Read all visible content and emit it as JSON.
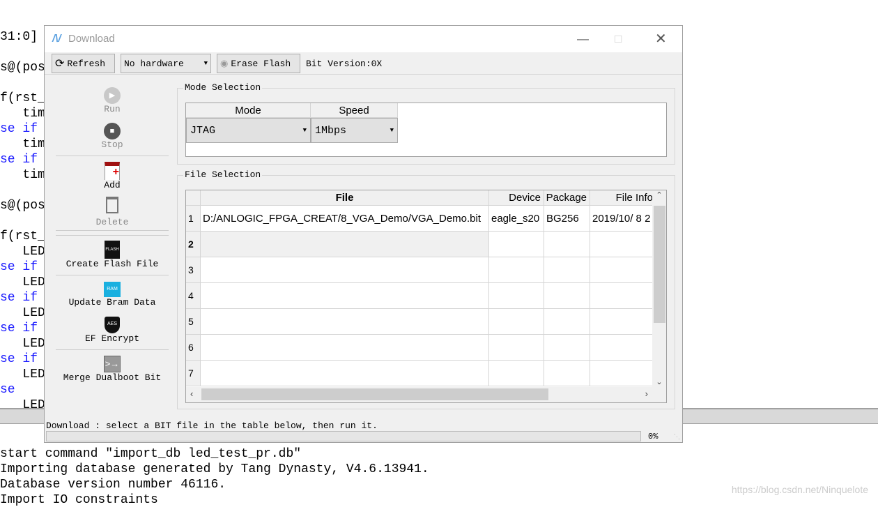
{
  "editor": {
    "lines": [
      {
        "text": "31:0]",
        "kw": false
      },
      {
        "text": "s@(pos",
        "kw": false
      },
      {
        "text": "f(rst_",
        "kw": false
      },
      {
        "text": "   tim",
        "kw": false
      },
      {
        "text": "se if",
        "kw": true
      },
      {
        "text": "   tim",
        "kw": false
      },
      {
        "text": "se if",
        "kw": true
      },
      {
        "text": "   tim",
        "kw": false
      },
      {
        "text": "s@(pos",
        "kw": false
      },
      {
        "text": "f(rst_",
        "kw": false
      },
      {
        "text": "   LED",
        "kw": false
      },
      {
        "text": "se if",
        "kw": true
      },
      {
        "text": "   LED",
        "kw": false
      },
      {
        "text": "se if",
        "kw": true
      },
      {
        "text": "   LED",
        "kw": false
      },
      {
        "text": "se if",
        "kw": true
      },
      {
        "text": "   LED",
        "kw": false
      },
      {
        "text": "se if",
        "kw": true
      },
      {
        "text": "   LED",
        "kw": false
      },
      {
        "text": "se",
        "kw": true
      },
      {
        "text": "   LED",
        "kw": false
      }
    ]
  },
  "console": [
    "start command \"import_db led_test_pr.db\"",
    "Importing database generated by Tang Dynasty, V4.6.13941.",
    "Database version number 46116.",
    "Import IO constraints"
  ],
  "watermark": "https://blog.csdn.net/Ninquelote",
  "dialog": {
    "title": "Download",
    "toolbar": {
      "refresh": "Refresh",
      "hardware": "No hardware",
      "erase": "Erase Flash",
      "bit_version": "Bit Version:0X"
    },
    "side": {
      "run": "Run",
      "stop": "Stop",
      "add": "Add",
      "delete": "Delete",
      "create_flash": "Create Flash File",
      "update_bram": "Update Bram Data",
      "ef_encrypt": "EF Encrypt",
      "merge": "Merge Dualboot Bit"
    },
    "mode_group": {
      "title": "Mode Selection",
      "mode_header": "Mode",
      "speed_header": "Speed",
      "mode_value": "JTAG",
      "speed_value": "1Mbps"
    },
    "file_group": {
      "title": "File Selection",
      "headers": [
        "File",
        "Device",
        "Package",
        "File Info"
      ],
      "rows": [
        {
          "num": "1",
          "file": "D:/ANLOGIC_FPGA_CREAT/8_VGA_Demo/VGA_Demo.bit",
          "device": "eagle_s20",
          "package": "BG256",
          "info": "2019/10/ 8 2"
        },
        {
          "num": "2"
        },
        {
          "num": "3"
        },
        {
          "num": "4"
        },
        {
          "num": "5"
        },
        {
          "num": "6"
        },
        {
          "num": "7"
        }
      ]
    },
    "status": "Download : select a BIT file in the table below, then run it.",
    "progress": {
      "value": 0,
      "label": "0%"
    }
  }
}
